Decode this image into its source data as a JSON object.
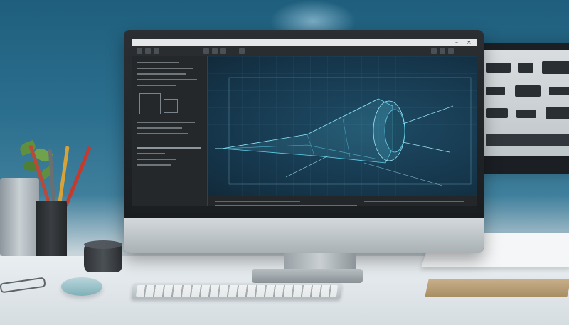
{
  "scene": {
    "description_objects": [
      "monitor",
      "keyboard",
      "mouse",
      "pencil-cup",
      "plant",
      "papers",
      "book"
    ],
    "colors": {
      "wall": "#2b6f8e",
      "desk": "#e9eef1",
      "screen_bg": "#1a1c1e",
      "wireframe": "#5fd0ea"
    }
  },
  "app": {
    "title": "",
    "toolbar_label": "",
    "viewport_header": "",
    "panel_label": "",
    "status_label": ""
  }
}
